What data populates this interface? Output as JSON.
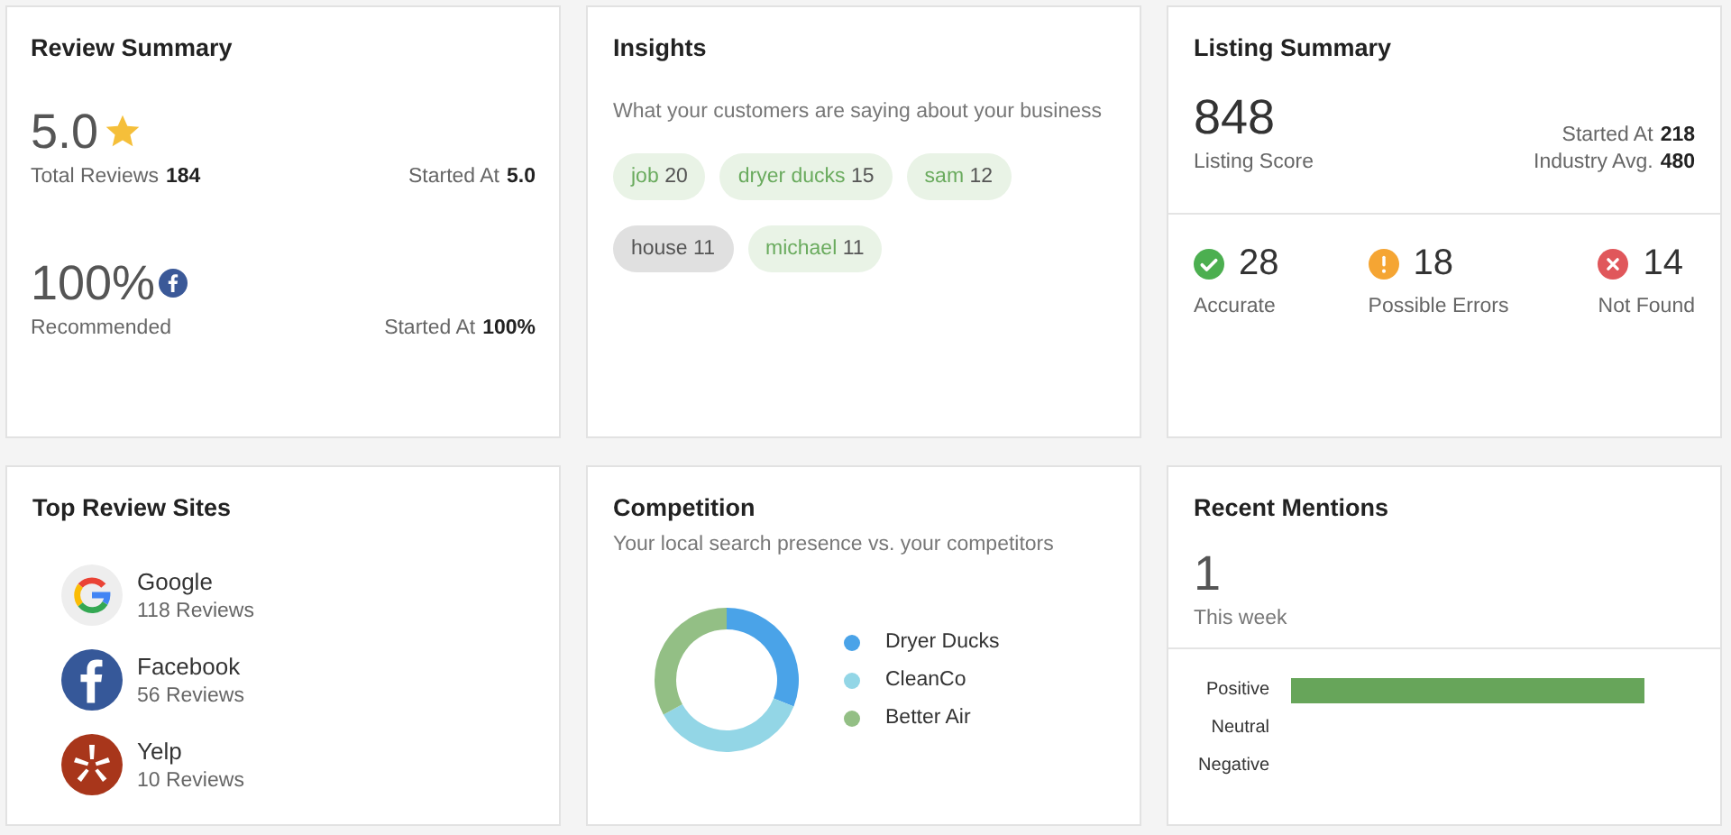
{
  "review_summary": {
    "title": "Review Summary",
    "rating": {
      "value": "5.0",
      "label": "Total Reviews",
      "count": "184",
      "started_label": "Started At",
      "started_value": "5.0"
    },
    "recommended": {
      "value": "100%",
      "label": "Recommended",
      "started_label": "Started At",
      "started_value": "100%"
    }
  },
  "insights": {
    "title": "Insights",
    "subtitle": "What your customers are saying about your business",
    "keywords": [
      {
        "word": "job",
        "count": "20",
        "selected": false
      },
      {
        "word": "dryer ducks",
        "count": "15",
        "selected": false
      },
      {
        "word": "sam",
        "count": "12",
        "selected": false
      },
      {
        "word": "house",
        "count": "11",
        "selected": true
      },
      {
        "word": "michael",
        "count": "11",
        "selected": false
      }
    ]
  },
  "listing_summary": {
    "title": "Listing Summary",
    "score": "848",
    "score_label": "Listing Score",
    "stats": [
      {
        "label": "Started At",
        "value": "218"
      },
      {
        "label": "Industry Avg.",
        "value": "480"
      }
    ],
    "statuses": [
      {
        "kind": "accurate",
        "count": "28",
        "label": "Accurate"
      },
      {
        "kind": "warning",
        "count": "18",
        "label": "Possible Errors"
      },
      {
        "kind": "error",
        "count": "14",
        "label": "Not Found"
      }
    ]
  },
  "top_review_sites": {
    "title": "Top Review Sites",
    "sites": [
      {
        "kind": "google",
        "name": "Google",
        "reviews": "118 Reviews"
      },
      {
        "kind": "facebook",
        "name": "Facebook",
        "reviews": "56 Reviews"
      },
      {
        "kind": "yelp",
        "name": "Yelp",
        "reviews": "10 Reviews"
      }
    ]
  },
  "competition": {
    "title": "Competition",
    "subtitle": "Your local search presence vs. your competitors",
    "legend": [
      {
        "name": "Dryer Ducks",
        "color": "#4aa3e8"
      },
      {
        "name": "CleanCo",
        "color": "#93d6e6"
      },
      {
        "name": "Better Air",
        "color": "#93bf85"
      }
    ]
  },
  "recent_mentions": {
    "title": "Recent Mentions",
    "count": "1",
    "period": "This week",
    "sentiment": [
      {
        "label": "Positive",
        "has_bar": true
      },
      {
        "label": "Neutral",
        "has_bar": false
      },
      {
        "label": "Negative",
        "has_bar": false
      }
    ]
  }
}
